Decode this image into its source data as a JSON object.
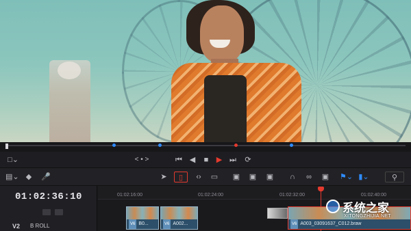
{
  "transport": {
    "jog_label": "< • >"
  },
  "timeline": {
    "timecode": "01:02:36:10",
    "ruler_ticks": [
      "01:02:16:00",
      "01:02:24:00",
      "01:02:32:00",
      "01:02:40:00"
    ],
    "track": {
      "id": "V2",
      "name": "B ROLL"
    },
    "clips": [
      {
        "label": "B0...",
        "badge": "V6"
      },
      {
        "label": "A002...",
        "badge": "V6"
      },
      {
        "label": "A003_03091637_C012.braw",
        "badge": "V6"
      }
    ]
  },
  "watermark": {
    "brand": "系统之家",
    "url": "XITONGZHIJIA.NET"
  },
  "colors": {
    "accent_red": "#e53a2e",
    "marker_blue": "#2f8cff",
    "clip_blue": "#3f6f8f"
  }
}
